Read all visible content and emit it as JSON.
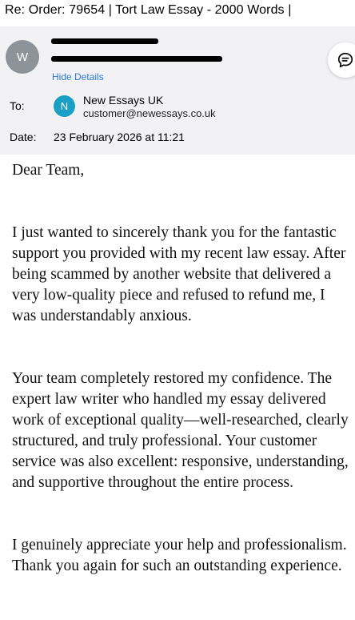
{
  "email": {
    "subject": "Re: Order: 79654 | Tort Law Essay - 2000 Words |",
    "sender": {
      "avatar_initial": "W",
      "hide_details_label": "Hide Details"
    },
    "to": {
      "label": "To:",
      "avatar_initial": "N",
      "name": "New Essays UK",
      "email": "customer@newessays.co.uk"
    },
    "date": {
      "label": "Date:",
      "value": "23 February 2026 at 11:21"
    },
    "reply_icon": "chat-bubble-icon",
    "body": {
      "greeting": "Dear Team,",
      "paragraph_1": "I just wanted to sincerely thank you for the fantastic support you provided with my recent law essay. After being scammed by another website that delivered a very low-quality piece and refused to refund me, I was understandably anxious.",
      "paragraph_2": "Your team completely restored my confidence. The expert law writer who handled my essay delivered work of exceptional quality—well-researched, clearly structured, and truly professional. Your customer service was also excellent: responsive, understanding, and supportive throughout the entire process.",
      "paragraph_3": "I genuinely appreciate your help and professionalism. Thank you again for such an outstanding experience."
    }
  },
  "colors": {
    "header_bg": "#f2f2f4",
    "link": "#2a79d6",
    "sender_avatar": "#8d9398",
    "recipient_avatar": "#1aa0c4"
  }
}
